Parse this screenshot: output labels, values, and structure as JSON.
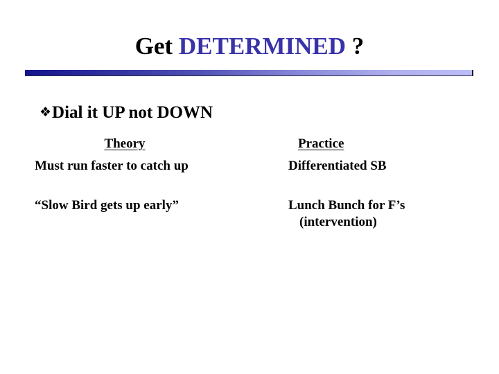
{
  "slide": {
    "title": {
      "part_plain_1": "Get ",
      "part_accent": "DETERMINED",
      "part_plain_2": " ?",
      "accent_color": "#3833A8",
      "plain_color": "#000000"
    },
    "divider": {
      "gradient_start": "#14148C",
      "gradient_end": "#BDBDF6"
    },
    "bullet": {
      "glyph": "❖",
      "glyph_name": "diamond-bullet",
      "text": "Dial it UP not DOWN"
    },
    "table": {
      "columns": [
        {
          "header": "Theory",
          "rows": [
            {
              "line_1": "Must run faster to catch up",
              "line_2": ""
            },
            {
              "line_1": "“Slow Bird gets up early”",
              "line_2": ""
            }
          ]
        },
        {
          "header": "Practice",
          "rows": [
            {
              "line_1": "Differentiated SB",
              "line_2": ""
            },
            {
              "line_1": "Lunch Bunch for F’s",
              "line_2": "(intervention)"
            }
          ]
        }
      ]
    }
  }
}
